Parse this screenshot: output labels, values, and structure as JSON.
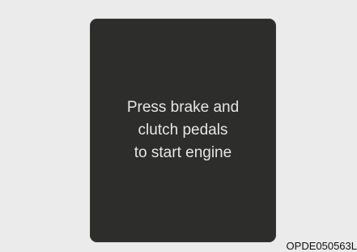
{
  "display": {
    "message_lines": [
      "Press brake and",
      "clutch pedals",
      "to start engine"
    ]
  },
  "figure_code": "OPDE050563L",
  "colors": {
    "background": "#ebebeb",
    "display_panel": "#2d2d2b",
    "message_text": "#e6e6e6"
  }
}
